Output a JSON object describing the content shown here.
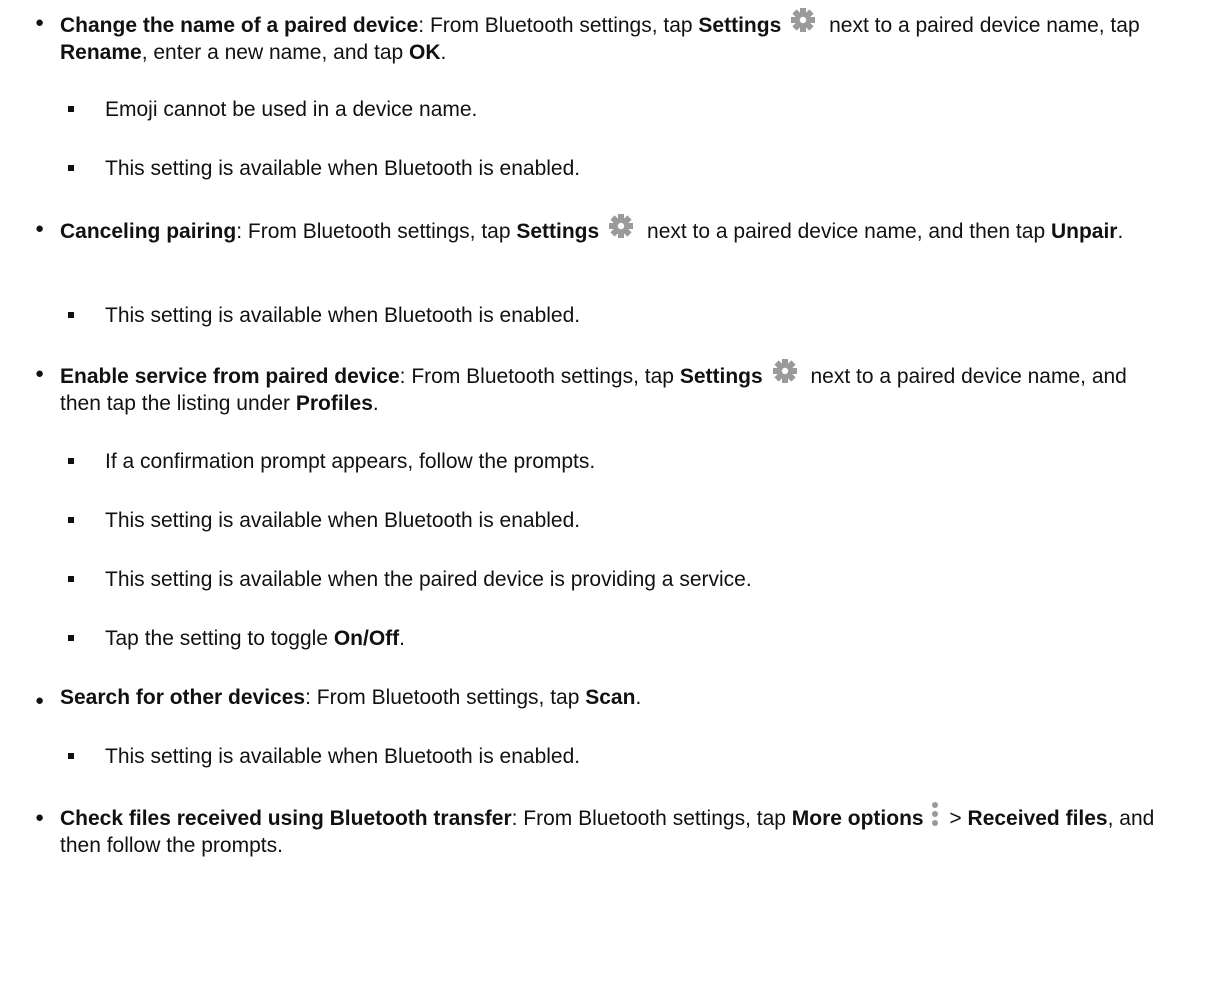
{
  "items": [
    {
      "bullet": "●",
      "title": "Change the name of a paired device",
      "t1": ": From Bluetooth settings, tap ",
      "b1": "Settings",
      "icon": "gear-icon",
      "t2": " next to a paired device name, tap ",
      "b2": "Rename",
      "t3": ", enter a new name, and tap ",
      "b3": "OK",
      "t4": ".",
      "subs": [
        "Emoji cannot be used in a device name.",
        "This setting is available when Bluetooth is enabled."
      ]
    },
    {
      "bullet": "●",
      "title": "Canceling pairing",
      "t1": ": From Bluetooth settings, tap ",
      "b1": "Settings",
      "icon": "gear-icon",
      "t2": " next to a paired device name, and then tap ",
      "b2": "Unpair",
      "t3": ".",
      "subs": [
        "This setting is available when Bluetooth is enabled."
      ]
    },
    {
      "bullet": "●",
      "title": "Enable service from paired device",
      "t1": ": From Bluetooth settings, tap ",
      "b1": "Settings",
      "icon": "gear-icon",
      "t2": " next to a paired device name, and then tap the listing under ",
      "b2": "Profiles",
      "t3": ".",
      "subs": [
        "If a confirmation prompt appears, follow the prompts.",
        "This setting is available when Bluetooth is enabled.",
        "This setting is available when the paired device is providing a service."
      ],
      "sub_last_pre": "Tap the setting to toggle ",
      "sub_last_bold": "On/Off",
      "sub_last_post": "."
    },
    {
      "bullet": "●",
      "title": "Search for other devices",
      "t1": ": From Bluetooth settings, tap ",
      "b1": "Scan",
      "t2": ".",
      "subs": [
        "This setting is available when Bluetooth is enabled."
      ]
    },
    {
      "bullet": "●",
      "title": "Check files received using Bluetooth transfer",
      "t1": ": From Bluetooth settings, tap ",
      "b1": "More options",
      "icon": "more-options-icon",
      "t2": " > ",
      "b2": "Received files",
      "t3": ", and then follow the prompts."
    }
  ]
}
